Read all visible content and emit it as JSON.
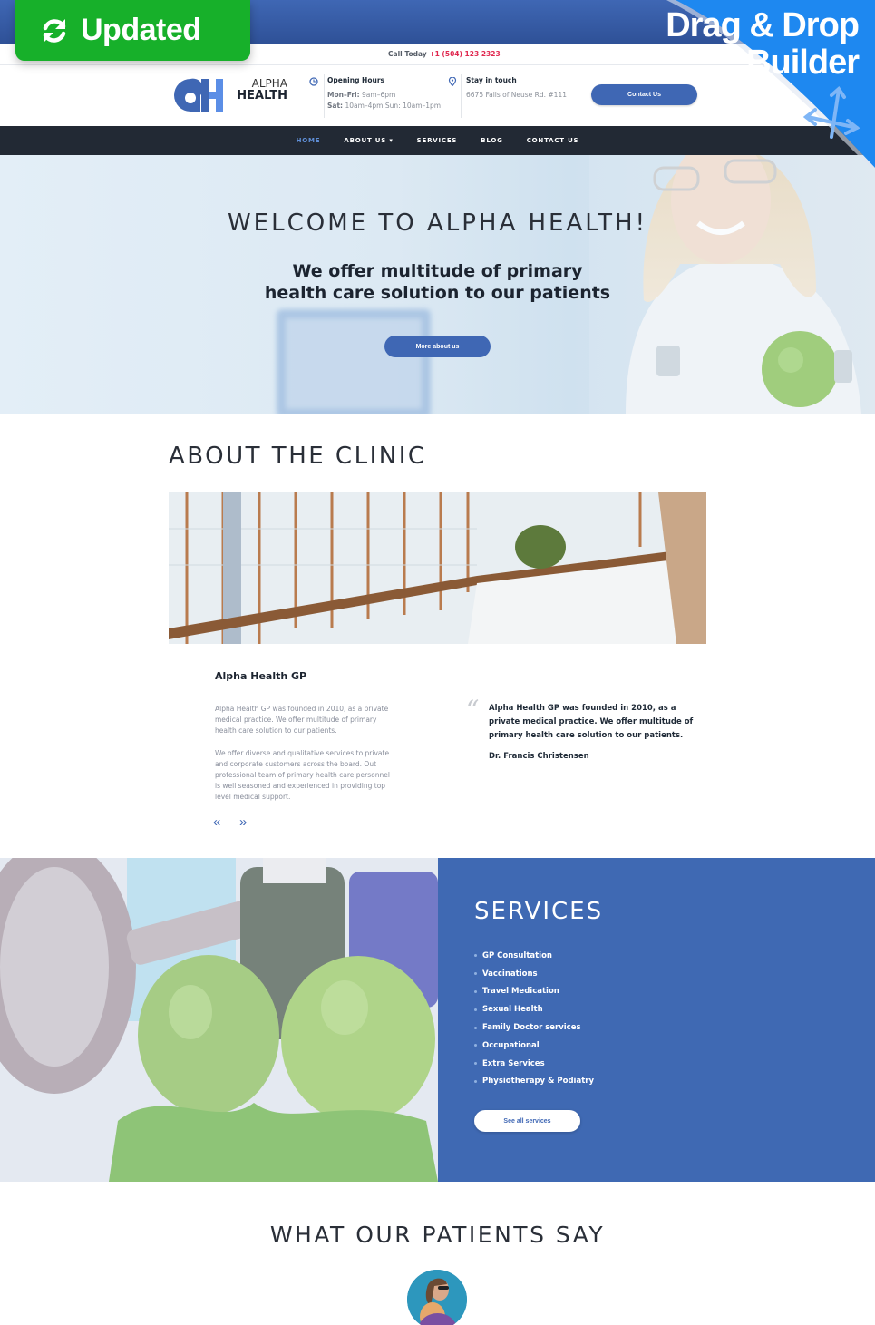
{
  "badges": {
    "updated_label": "Updated",
    "builder_line1": "Drag & Drop",
    "builder_line2": "Builder"
  },
  "topbar": {
    "call_label": "Call Today",
    "phone": "+1 (504) 123 2323"
  },
  "header": {
    "logo_line1": "ALPHA",
    "logo_line2": "HEALTH",
    "hours": {
      "title": "Opening Hours",
      "weekday_label": "Mon–Fri:",
      "weekday_value": "9am–6pm",
      "sat_label": "Sat:",
      "sat_value": "10am–4pm",
      "sun_label": "Sun:",
      "sun_value": "10am–1pm"
    },
    "contact": {
      "title": "Stay in touch",
      "address": "6675 Falls of Neuse Rd. #111"
    },
    "contact_button": "Contact Us"
  },
  "nav": {
    "items": [
      {
        "label": "HOME",
        "active": true
      },
      {
        "label": "ABOUT US ▾",
        "active": false
      },
      {
        "label": "SERVICES",
        "active": false
      },
      {
        "label": "BLOG",
        "active": false
      },
      {
        "label": "CONTACT US",
        "active": false
      }
    ]
  },
  "hero": {
    "title": "WELCOME TO ALPHA HEALTH!",
    "subtitle_line1": "We offer multitude of primary",
    "subtitle_line2": "health care solution to our patients",
    "button": "More about us"
  },
  "about": {
    "title": "ABOUT THE CLINIC",
    "subtitle": "Alpha Health GP",
    "paragraph1": "Alpha Health GP was founded in 2010, as a private medical practice. We offer multitude of primary health care solution to our patients.",
    "paragraph2": "We offer diverse and qualitative services to private and corporate customers across the board. Out professional team of primary health care personnel is well seasoned and experienced in providing top level medical support.",
    "prev_icon": "«",
    "next_icon": "»",
    "quote_mark": "“",
    "quote": "Alpha Health GP was founded in 2010, as a private medical practice. We offer multitude of primary health care solution to our patients.",
    "quote_author": "Dr. Francis Christensen"
  },
  "services": {
    "title": "SERVICES",
    "items": [
      "GP Consultation",
      "Vaccinations",
      "Travel Medication",
      "Sexual Health",
      "Family Doctor services",
      "Occupational",
      "Extra Services",
      "Physiotherapy & Podiatry"
    ],
    "button": "See all services"
  },
  "testimonials": {
    "title": "WHAT OUR PATIENTS SAY"
  },
  "colors": {
    "brand_blue": "#3f67b4",
    "nav_dark": "#222934",
    "updated_green": "#17b02a",
    "phone_red": "#e0284f",
    "ribbon_blue": "#1e88f0"
  }
}
